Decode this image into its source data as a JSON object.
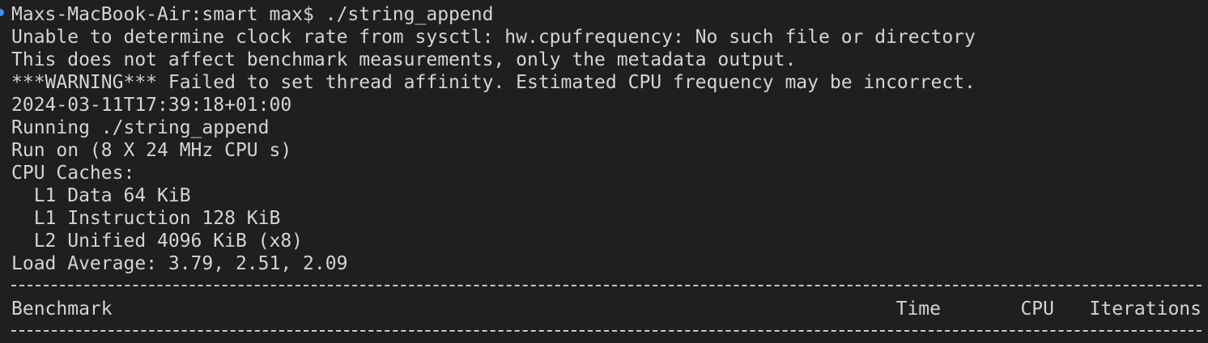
{
  "terminal": {
    "lines": [
      "Maxs-MacBook-Air:smart max$ ./string_append",
      "Unable to determine clock rate from sysctl: hw.cpufrequency: No such file or directory",
      "This does not affect benchmark measurements, only the metadata output.",
      "***WARNING*** Failed to set thread affinity. Estimated CPU frequency may be incorrect.",
      "2024-03-11T17:39:18+01:00",
      "Running ./string_append",
      "Run on (8 X 24 MHz CPU s)",
      "CPU Caches:",
      "  L1 Data 64 KiB",
      "  L1 Instruction 128 KiB",
      "  L2 Unified 4096 KiB (x8)",
      "Load Average: 3.79, 2.51, 2.09"
    ],
    "table_header": {
      "benchmark": "Benchmark",
      "time": "Time",
      "cpu": "CPU",
      "iterations": "Iterations"
    }
  },
  "colors": {
    "background": "#1f1f1f",
    "text": "#d4d4d4",
    "prompt_marker": "#3794ff"
  }
}
